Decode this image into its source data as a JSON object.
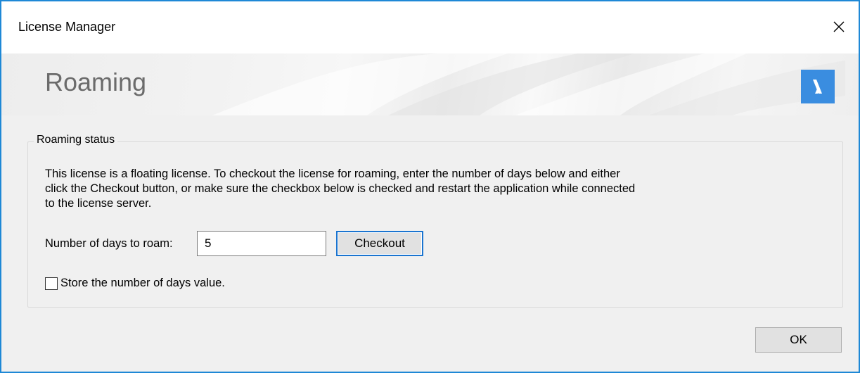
{
  "window": {
    "title": "License Manager",
    "accent_color": "#1e88d6"
  },
  "banner": {
    "title": "Roaming",
    "logo_icon": "bricscad-logo-icon",
    "logo_color": "#3a8de0"
  },
  "roaming_status": {
    "legend": "Roaming status",
    "description": "This license is a floating license. To checkout the license for roaming, enter the number of days below and either click the Checkout button, or make sure the checkbox below is checked and restart the application while connected to the license server.",
    "days_label": "Number of days to roam:",
    "days_value": "5",
    "checkout_label": "Checkout",
    "store_checkbox_label": "Store the number of days value.",
    "store_checked": false
  },
  "footer": {
    "ok_label": "OK"
  }
}
